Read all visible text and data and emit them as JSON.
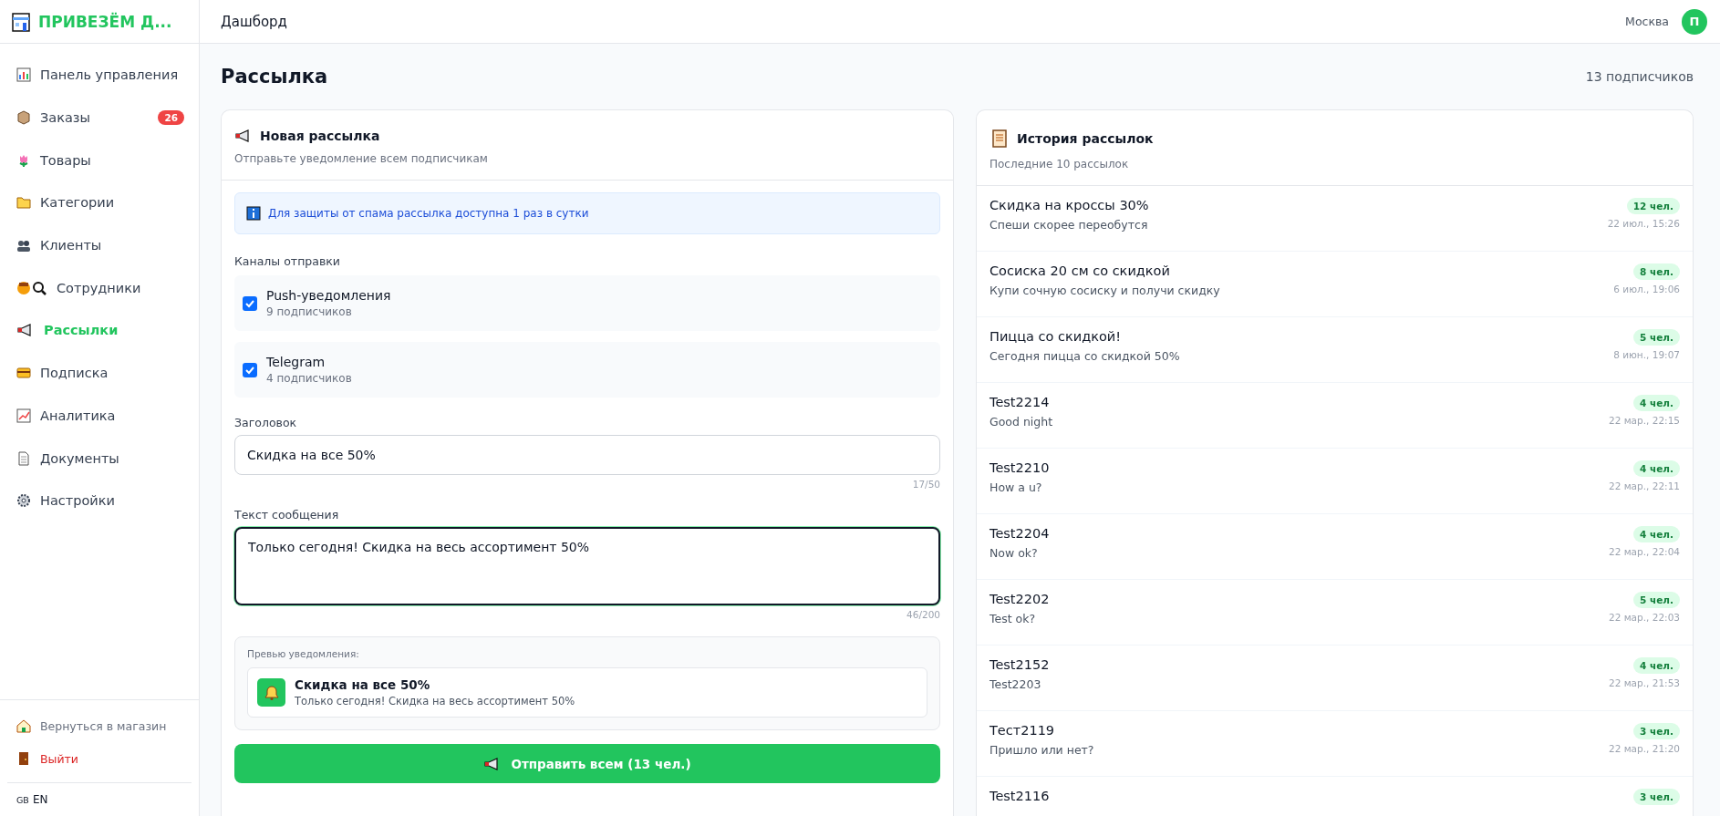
{
  "brand": {
    "name": "ПРИВЕЗЁМ Д..."
  },
  "sidebar": {
    "items": [
      {
        "label": "Панель управления",
        "selected": false
      },
      {
        "label": "Заказы",
        "selected": false,
        "badge": "26"
      },
      {
        "label": "Товары",
        "selected": false
      },
      {
        "label": "Категории",
        "selected": false
      },
      {
        "label": "Клиенты",
        "selected": false
      },
      {
        "label": "Сотрудники",
        "selected": false
      },
      {
        "label": "Рассылки",
        "selected": true
      },
      {
        "label": "Подписка",
        "selected": false
      },
      {
        "label": "Аналитика",
        "selected": false
      },
      {
        "label": "Документы",
        "selected": false
      },
      {
        "label": "Настройки",
        "selected": false
      }
    ],
    "footer": [
      {
        "label": "Вернуться в магазин",
        "kind": "store"
      },
      {
        "label": "Выйти",
        "kind": "logout"
      }
    ],
    "language": {
      "flag": "GB",
      "code": "EN"
    }
  },
  "header": {
    "title": "Дашборд",
    "city": "Москва",
    "avatar": "П"
  },
  "page": {
    "title": "Рассылка",
    "subscribers": "13 подписчиков"
  },
  "compose": {
    "title": "Новая рассылка",
    "subtitle": "Отправьте уведомление всем подписчикам",
    "notice": "Для защиты от спама рассылка доступна 1 раз в сутки",
    "channels_label": "Каналы отправки",
    "channels": [
      {
        "name": "Push-уведомления",
        "count": "9 подписчиков",
        "checked": true
      },
      {
        "name": "Telegram",
        "count": "4 подписчиков",
        "checked": true
      }
    ],
    "title_field": {
      "label": "Заголовок",
      "value": "Скидка на все 50%",
      "counter": "17/50",
      "focused": false
    },
    "message_field": {
      "label": "Текст сообщения",
      "value": "Только сегодня! Скидка на весь ассортимент 50%",
      "counter": "46/200",
      "focused": true
    },
    "preview": {
      "label": "Превью уведомления:",
      "title": "Скидка на все 50%",
      "text": "Только сегодня! Скидка на весь ассортимент 50%"
    },
    "send_button": "Отправить всем (13 чел.)"
  },
  "history": {
    "title": "История рассылок",
    "subtitle": "Последние 10 рассылок",
    "rows": [
      {
        "title": "Скидка на кроссы 30%",
        "text": "Спеши скорее переобутся",
        "count": "12 чел.",
        "date": "22 июл., 15:26"
      },
      {
        "title": "Сосиска 20 см со скидкой",
        "text": "Купи сочную сосиску и получи скидку",
        "count": "8 чел.",
        "date": "6 июл., 19:06"
      },
      {
        "title": "Пицца со скидкой!",
        "text": "Сегодня пицца со скидкой 50%",
        "count": "5 чел.",
        "date": "8 июн., 19:07"
      },
      {
        "title": "Test2214",
        "text": "Good night",
        "count": "4 чел.",
        "date": "22 мар., 22:15"
      },
      {
        "title": "Test2210",
        "text": "How a u?",
        "count": "4 чел.",
        "date": "22 мар., 22:11"
      },
      {
        "title": "Test2204",
        "text": "Now ok?",
        "count": "4 чел.",
        "date": "22 мар., 22:04"
      },
      {
        "title": "Test2202",
        "text": "Test ok?",
        "count": "5 чел.",
        "date": "22 мар., 22:03"
      },
      {
        "title": "Test2152",
        "text": "Test2203",
        "count": "4 чел.",
        "date": "22 мар., 21:53"
      },
      {
        "title": "Тест2119",
        "text": "Пришло или нет?",
        "count": "3 чел.",
        "date": "22 мар., 21:20"
      },
      {
        "title": "Test2116",
        "count": "3 чел."
      }
    ]
  }
}
